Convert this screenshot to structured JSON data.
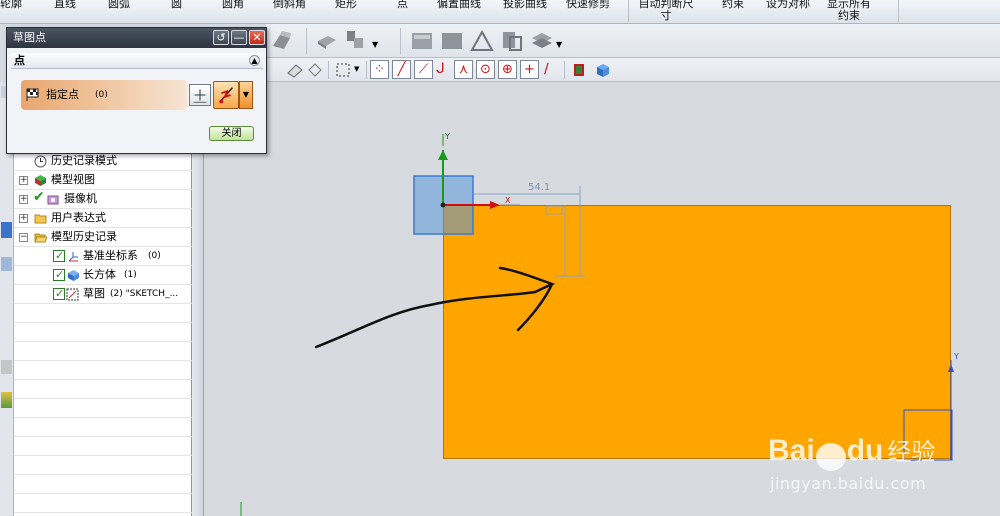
{
  "ribbon": {
    "items": [
      "轮廓",
      "直线",
      "圆弧",
      "圆",
      "圆角",
      "倒斜角",
      "矩形",
      "点",
      "偏置曲线",
      "投影曲线",
      "快速修剪",
      "自动判断尺寸",
      "约束",
      "设为对称",
      "显示所有约束"
    ]
  },
  "dialog": {
    "title": "草图点",
    "section_title": "点",
    "select_label": "指定点",
    "select_count": "(0)",
    "close_label": "关闭"
  },
  "navigator": {
    "items": [
      {
        "label": "历史记录模式",
        "icon": "clock-icon"
      },
      {
        "label": "模型视图",
        "icon": "model-views-icon"
      },
      {
        "label": "摄像机",
        "icon": "camera-icon"
      },
      {
        "label": "用户表达式",
        "icon": "folder-icon"
      },
      {
        "label": "模型历史记录",
        "icon": "folder-open-icon"
      },
      {
        "label": "基准坐标系",
        "count": "(0)",
        "icon": "datum-csys-icon"
      },
      {
        "label": "长方体",
        "count": "(1)",
        "icon": "block-icon"
      },
      {
        "label": "草图",
        "count": "(2) \"SKETCH_...",
        "icon": "sketch-icon"
      }
    ]
  },
  "canvas": {
    "dimension_value": "54.1",
    "axis_y": "Y",
    "axis_x": "X"
  },
  "watermark": {
    "brand_latin": "Bai",
    "brand_suffix": "du",
    "brand_cn": "经验",
    "url": "jingyan.baidu.com"
  },
  "colors": {
    "sheet_fill": "#fea500",
    "dialog_title_bg": "#2d3440",
    "selection_row": "#e9a66e"
  }
}
